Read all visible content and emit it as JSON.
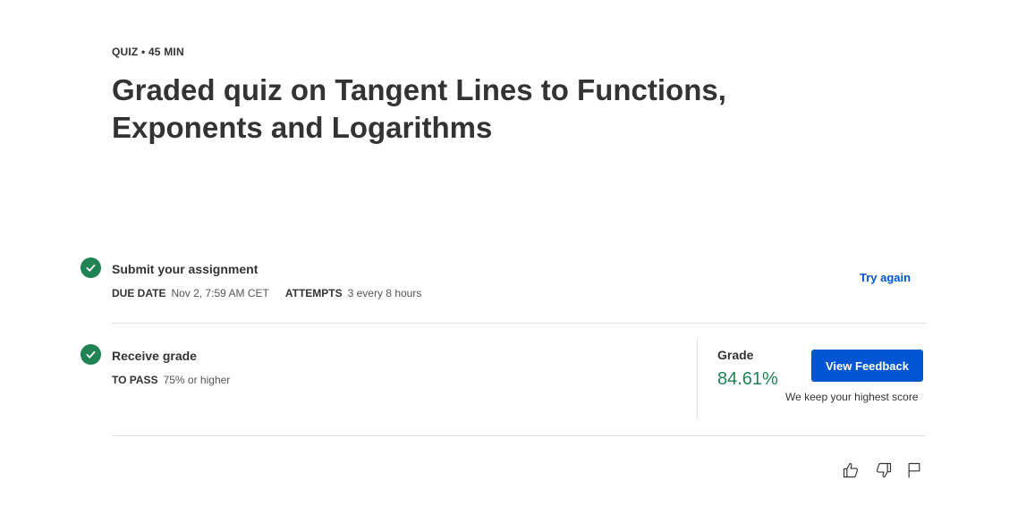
{
  "header": {
    "eyebrow": "QUIZ • 45 MIN",
    "title": "Graded quiz on Tangent Lines to Functions, Exponents and Logarithms"
  },
  "steps": {
    "submit": {
      "title": "Submit your assignment",
      "due_label": "DUE DATE",
      "due_value": "Nov 2, 7:59 AM CET",
      "attempts_label": "ATTEMPTS",
      "attempts_value": "3 every 8 hours",
      "action_label": "Try again",
      "status_icon": "check-circle-icon"
    },
    "grade": {
      "title": "Receive grade",
      "pass_label": "TO PASS",
      "pass_value": "75% or higher",
      "status_icon": "check-circle-icon",
      "grade_label": "Grade",
      "grade_value": "84.61%",
      "feedback_button": "View Feedback",
      "note": "We keep your highest score"
    }
  },
  "footer_actions": [
    "thumbs-up-icon",
    "thumbs-down-icon",
    "flag-icon"
  ],
  "colors": {
    "success": "#1f8354",
    "link": "#0056d2",
    "divider": "#e1e1e1"
  }
}
